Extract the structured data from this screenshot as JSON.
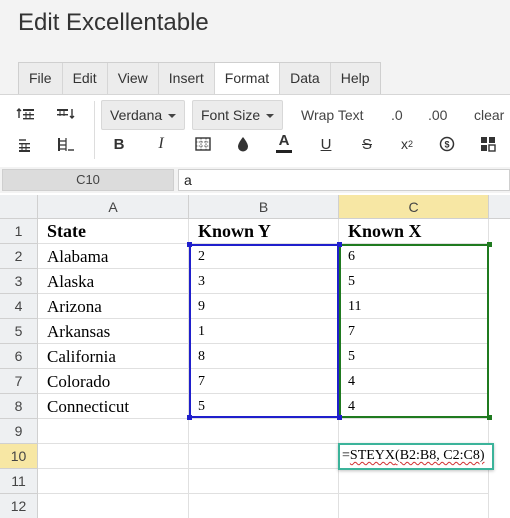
{
  "app": {
    "title": "Edit Excellentable"
  },
  "menu": {
    "items": [
      "File",
      "Edit",
      "View",
      "Insert",
      "Format",
      "Data",
      "Help"
    ],
    "active": "Format"
  },
  "toolbar": {
    "font_family": "Verdana",
    "font_size": "Font Size",
    "wrap_text": "Wrap Text",
    "decimal_less": ".0",
    "decimal_more": ".00",
    "clear": "clear"
  },
  "formula_bar": {
    "cell_ref": "C10",
    "value": "a"
  },
  "grid": {
    "columns": [
      "A",
      "B",
      "C"
    ],
    "rows": [
      "1",
      "2",
      "3",
      "4",
      "5",
      "6",
      "7",
      "8",
      "9",
      "10",
      "11",
      "12"
    ],
    "selected_column": "C",
    "selected_row": "10",
    "headers": {
      "a": "State",
      "b": "Known Y",
      "c": "Known X"
    },
    "data": [
      {
        "state": "Alabama",
        "y": "2",
        "x": "6"
      },
      {
        "state": "Alaska",
        "y": "3",
        "x": "5"
      },
      {
        "state": "Arizona",
        "y": "9",
        "x": "11"
      },
      {
        "state": "Arkansas",
        "y": "1",
        "x": "7"
      },
      {
        "state": "California",
        "y": "8",
        "x": "5"
      },
      {
        "state": "Colorado",
        "y": "7",
        "x": "4"
      },
      {
        "state": "Connecticut",
        "y": "5",
        "x": "4"
      }
    ],
    "editor": {
      "prefix": "=",
      "func": "STEYX",
      "args": "(B2:B8, C2:C8)"
    }
  },
  "colors": {
    "range_y": "#1f1fcc",
    "range_x": "#1f7a1f",
    "editor_border": "#3bb39a",
    "selected_header": "#f7e7a4"
  }
}
